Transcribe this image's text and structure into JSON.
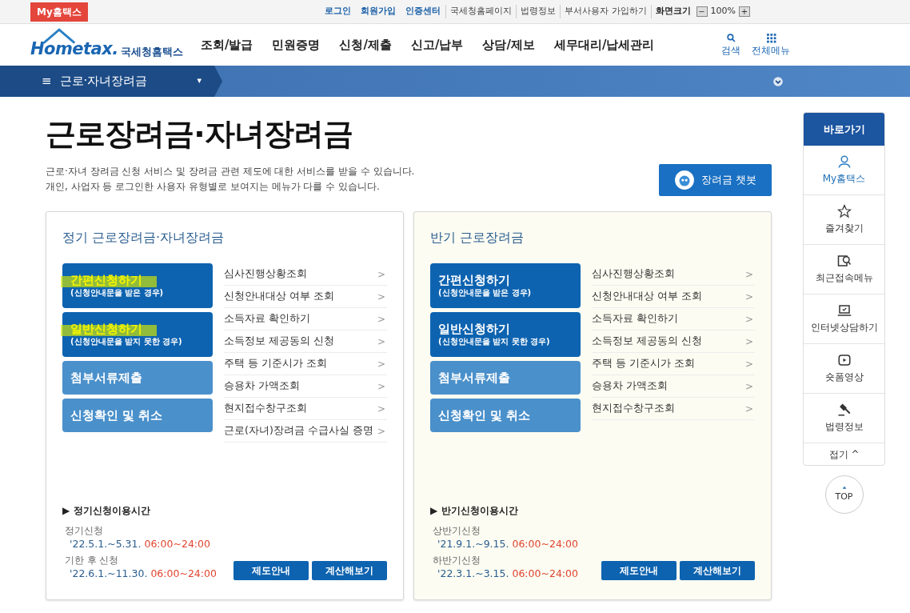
{
  "top_bar": {
    "my_button": "My홈택스",
    "links": [
      {
        "label": "로그인",
        "kind": "strong"
      },
      {
        "label": "회원가입",
        "kind": "strong"
      },
      {
        "label": "인증센터",
        "kind": "strong"
      },
      {
        "label": "국세청홈페이지",
        "kind": "plain"
      },
      {
        "label": "법령정보",
        "kind": "plain"
      },
      {
        "label": "부서사용자 가입하기",
        "kind": "plain"
      }
    ],
    "zoom_label": "화면크기",
    "zoom_minus": "−",
    "zoom_value": "100%",
    "zoom_plus": "+"
  },
  "header": {
    "logo_text": "Hometax.",
    "logo_subtitle": "국세청홈택스",
    "menu": [
      "조회/발급",
      "민원증명",
      "신청/제출",
      "신고/납부",
      "상담/제보",
      "세무대리/납세관리"
    ],
    "search_label": "검색",
    "all_menu_label": "전체메뉴"
  },
  "breadcrumb": {
    "menu_glyph": "≡",
    "label": "근로·자녀장려금",
    "caret": "▾"
  },
  "page": {
    "title": "근로장려금·자녀장려금",
    "description": [
      "근로·자녀 장려금 신청 서비스 및 장려금 관련 제도에 대한 서비스를 받을 수 있습니다.",
      "개인, 사업자 등 로그인한 사용자 유형별로 보여지는 메뉴가 다를 수 있습니다."
    ],
    "chatbot_button": "장려금 챗봇"
  },
  "panels": [
    {
      "title": "정기 근로장려금·자녀장려금",
      "kind": "plain",
      "actions": [
        {
          "label": "간편신청하기",
          "note": "(신청안내문을 받은 경우)",
          "kind": "primary",
          "highlighted": true
        },
        {
          "label": "일반신청하기",
          "note": "(신청안내문을 받지 못한 경우)",
          "kind": "primary",
          "highlighted": true
        },
        {
          "label": "첨부서류제출",
          "kind": "secondary",
          "highlighted": false
        },
        {
          "label": "신청확인 및 취소",
          "kind": "secondary",
          "highlighted": false
        }
      ],
      "links": [
        "심사진행상황조회",
        "신청안내대상 여부 조회",
        "소득자료 확인하기",
        "소득정보 제공동의 신청",
        "주택 등 기준시가 조회",
        "승용차 가액조회",
        "현지접수창구조회",
        "근로(자녀)장려금 수급사실 증명"
      ],
      "link_arrow": ">",
      "schedule_title": "정기신청이용시간",
      "schedule_marker": "▶",
      "schedule": [
        {
          "label": "정기신청",
          "dates": "'22.5.1.~5.31.",
          "hours": "06:00~24:00"
        },
        {
          "label": "기한 후 신청",
          "dates": "'22.6.1.~11.30.",
          "hours": "06:00~24:00"
        }
      ],
      "buttons": [
        "제도안내",
        "계산해보기"
      ]
    },
    {
      "title": "반기 근로장려금",
      "kind": "tinted",
      "actions": [
        {
          "label": "간편신청하기",
          "note": "(신청안내문을 받은 경우)",
          "kind": "primary",
          "highlighted": false
        },
        {
          "label": "일반신청하기",
          "note": "(신청안내문을 받지 못한 경우)",
          "kind": "primary",
          "highlighted": false
        },
        {
          "label": "첨부서류제출",
          "kind": "secondary",
          "highlighted": false
        },
        {
          "label": "신청확인 및 취소",
          "kind": "secondary",
          "highlighted": false
        }
      ],
      "links": [
        "심사진행상황조회",
        "신청안내대상 여부 조회",
        "소득자료 확인하기",
        "소득정보 제공동의 신청",
        "주택 등 기준시가 조회",
        "승용차 가액조회",
        "현지접수창구조회"
      ],
      "link_arrow": ">",
      "schedule_title": "반기신청이용시간",
      "schedule_marker": "▶",
      "schedule": [
        {
          "label": "상반기신청",
          "dates": "'21.9.1.~9.15.",
          "hours": "06:00~24:00"
        },
        {
          "label": "하반기신청",
          "dates": "'22.3.1.~3.15.",
          "hours": "06:00~24:00"
        }
      ],
      "buttons": [
        "제도안내",
        "계산해보기"
      ]
    }
  ],
  "quick_menu": {
    "title": "바로가기",
    "items": [
      {
        "label": "My홈택스",
        "kind": "user",
        "selected": true
      },
      {
        "label": "즐겨찾기",
        "kind": "star",
        "selected": false
      },
      {
        "label": "최근접속메뉴",
        "kind": "recent",
        "selected": false
      },
      {
        "label": "인터넷상담하기",
        "kind": "laptop",
        "selected": false
      },
      {
        "label": "숏폼영상",
        "kind": "video",
        "selected": false
      },
      {
        "label": "법령정보",
        "kind": "gavel",
        "selected": false
      }
    ],
    "collapse": "접기 ^",
    "top_button": "TOP"
  }
}
